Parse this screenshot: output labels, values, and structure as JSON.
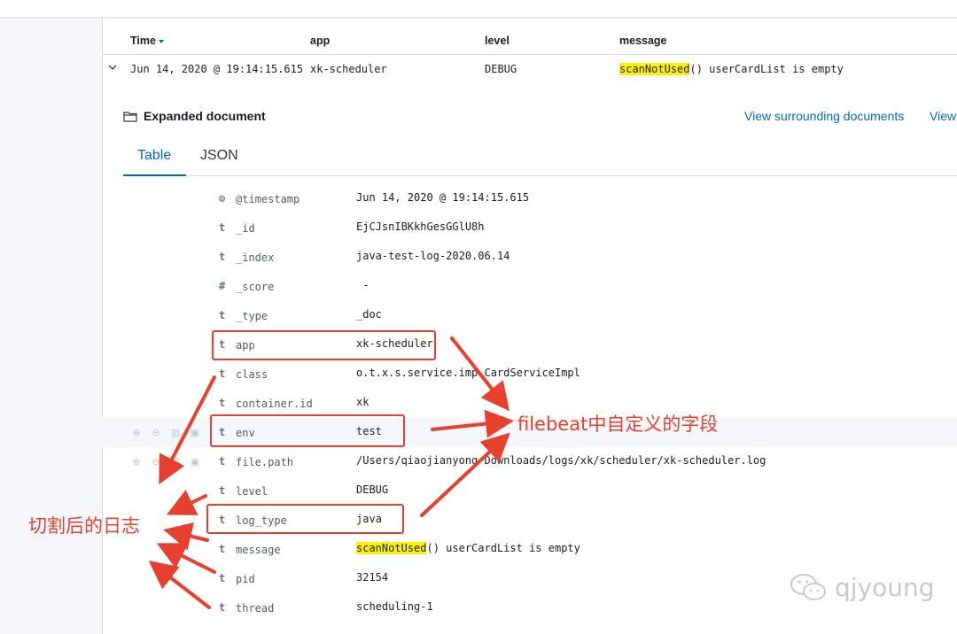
{
  "table": {
    "headers": {
      "time": "Time",
      "app": "app",
      "level": "level",
      "message": "message"
    },
    "row": {
      "time": "Jun 14, 2020 @ 19:14:15.615",
      "app": "xk-scheduler",
      "level": "DEBUG",
      "message_highlight": "scanNotUsed",
      "message_rest": "() userCardList is empty"
    }
  },
  "expanded": {
    "title": "Expanded document",
    "link_surrounding": "View surrounding documents",
    "link_single": "View",
    "tabs": [
      "Table",
      "JSON"
    ]
  },
  "fields": [
    {
      "type": "clock-icon",
      "type_glyph": "⊙",
      "name": "@timestamp",
      "value": "Jun 14, 2020 @ 19:14:15.615"
    },
    {
      "type": "string-icon",
      "type_glyph": "t",
      "name": "_id",
      "value": "EjCJsnIBKkhGesGGlU8h"
    },
    {
      "type": "string-icon",
      "type_glyph": "t",
      "name": "_index",
      "value": "java-test-log-2020.06.14"
    },
    {
      "type": "number-icon",
      "type_glyph": "#",
      "name": "_score",
      "value": " -"
    },
    {
      "type": "string-icon",
      "type_glyph": "t",
      "name": "_type",
      "value": "_doc"
    },
    {
      "type": "string-icon",
      "type_glyph": "t",
      "name": "app",
      "value": "xk-scheduler"
    },
    {
      "type": "string-icon",
      "type_glyph": "t",
      "name": "class",
      "value": "o.t.x.s.service.imp CardServiceImpl"
    },
    {
      "type": "string-icon",
      "type_glyph": "t",
      "name": "container.id",
      "value": "xk"
    },
    {
      "type": "string-icon",
      "type_glyph": "t",
      "name": "env",
      "value": "test"
    },
    {
      "type": "string-icon",
      "type_glyph": "t",
      "name": "file.path",
      "value": "/Users/qiaojianyong Downloads/logs/xk/scheduler/xk-scheduler.log"
    },
    {
      "type": "string-icon",
      "type_glyph": "t",
      "name": "level",
      "value": "DEBUG"
    },
    {
      "type": "string-icon",
      "type_glyph": "t",
      "name": "log_type",
      "value": "java"
    },
    {
      "type": "string-icon",
      "type_glyph": "t",
      "name": "message",
      "value_highlight": "scanNotUsed",
      "value_rest": "() userCardList is empty"
    },
    {
      "type": "string-icon",
      "type_glyph": "t",
      "name": "pid",
      "value": "32154"
    },
    {
      "type": "string-icon",
      "type_glyph": "t",
      "name": "thread",
      "value": "scheduling-1"
    }
  ],
  "annotations": {
    "right_label": "filebeat中自定义的字段",
    "left_label": "切割后的日志",
    "color": "#e8402f"
  },
  "watermark": {
    "text": "qjyoung",
    "icon": "wechat-icon"
  },
  "colors": {
    "accent": "#006bb8",
    "highlight": "#fff200",
    "annotation": "#e8402f"
  }
}
